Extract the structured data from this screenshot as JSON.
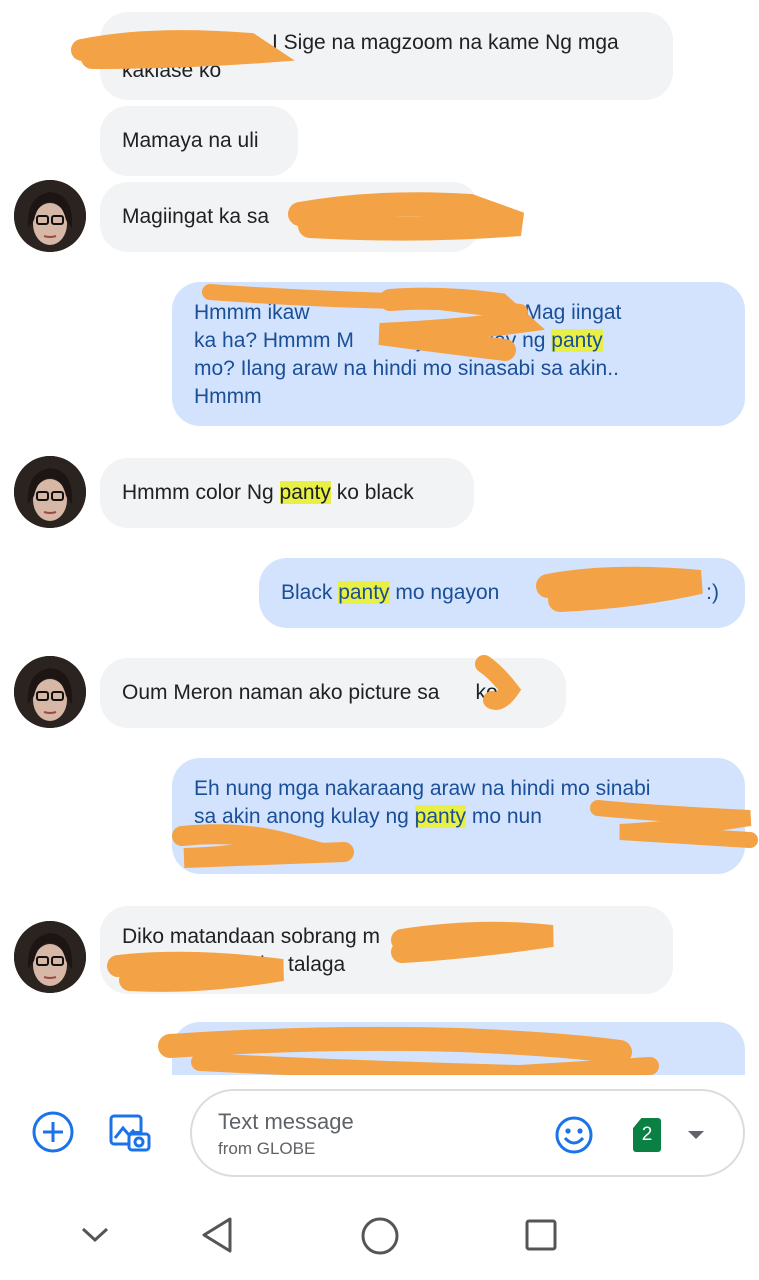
{
  "messages": [
    {
      "side": "incoming",
      "lines": [
        "I Sige na magzoom na kame Ng mga",
        "kaklase ko"
      ]
    },
    {
      "side": "incoming",
      "text": "Mamaya na uli"
    },
    {
      "side": "incoming",
      "text": "Magiingat ka sa"
    },
    {
      "side": "outgoing",
      "lines": [
        "Hmmm ikaw",
        "Mag iingat",
        "ka ha? Hmmm M",
        "yung kulay ng",
        "panty",
        "mo? Ilang araw na hindi mo sinasabi sa akin..",
        "Hmmm"
      ]
    },
    {
      "side": "incoming",
      "before": "Hmmm color Ng ",
      "highlight": "panty",
      "after": " ko black"
    },
    {
      "side": "outgoing",
      "before": "Black ",
      "highlight": "panty",
      "after": " mo ngayon",
      "end": ":)"
    },
    {
      "side": "incoming",
      "before": "Oum Meron naman ako picture sa",
      "after": "ko"
    },
    {
      "side": "outgoing",
      "lines": [
        "Eh nung mga nakaraang araw na hindi mo sinabi",
        "sa akin anong kulay ng ",
        "panty",
        " mo nun"
      ]
    },
    {
      "side": "incoming",
      "lines": [
        "Diko matandaan sobrang m",
        "ko talaga"
      ]
    }
  ],
  "composer": {
    "placeholder": "Text message",
    "sub_label": "from GLOBE",
    "sim_number": "2"
  },
  "icons": {
    "add": "add-circle-icon",
    "gallery": "gallery-icon",
    "emoji": "emoji-icon",
    "sim": "sim-card-icon",
    "dropdown": "dropdown-arrow-icon",
    "nav_down": "nav-collapse-icon",
    "nav_back": "nav-back-icon",
    "nav_home": "nav-home-icon",
    "nav_recents": "nav-recents-icon"
  },
  "colors": {
    "incoming_bubble": "#f1f3f4",
    "outgoing_bubble": "#d3e3fd",
    "outgoing_text": "#1a4f97",
    "highlight": "#e8f045",
    "accent": "#1a73e8",
    "redaction": "#f4a246"
  }
}
